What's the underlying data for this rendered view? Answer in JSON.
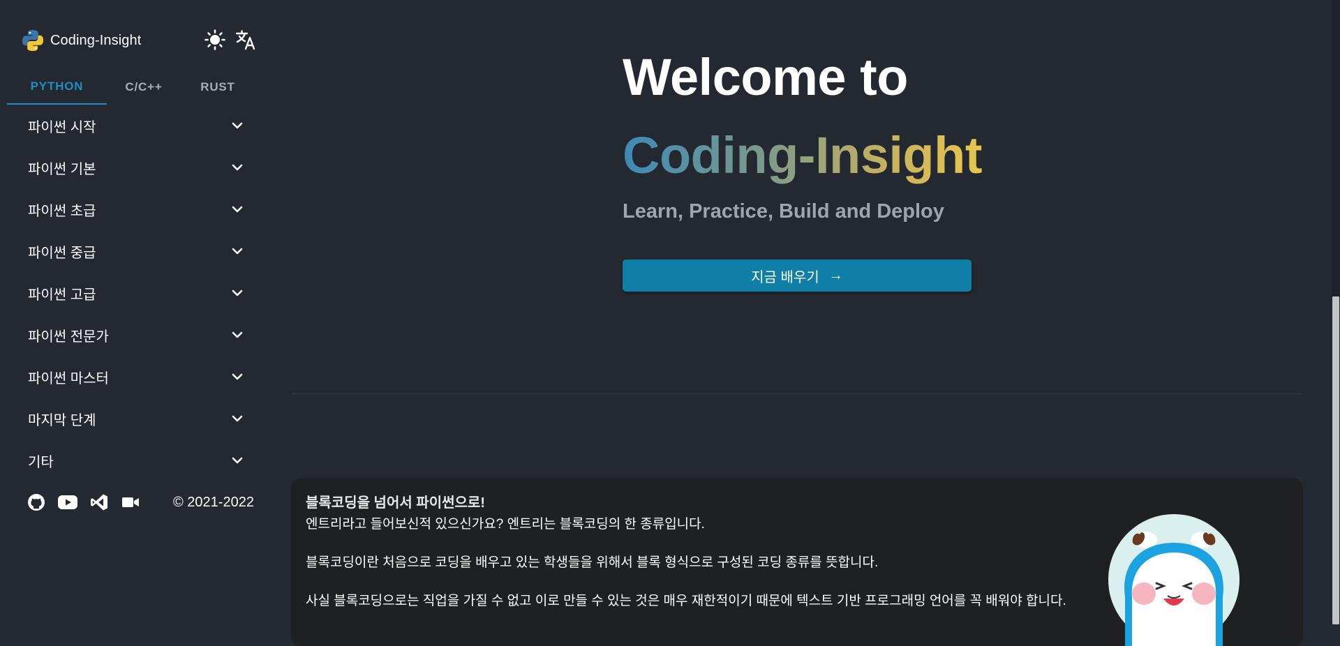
{
  "brand": {
    "name": "Coding-Insight"
  },
  "icons": {
    "logo": "python-logo-icon",
    "theme": "sun-icon",
    "language": "translate-icon",
    "chevron": "chevron-down-icon",
    "footer": [
      "github-icon",
      "youtube-icon",
      "vscode-icon",
      "video-camera-icon"
    ]
  },
  "tabs": [
    {
      "label": "PYTHON",
      "active": true
    },
    {
      "label": "C/C++",
      "active": false
    },
    {
      "label": "RUST",
      "active": false
    }
  ],
  "menu": [
    {
      "label": "파이썬 시작"
    },
    {
      "label": "파이썬 기본"
    },
    {
      "label": "파이썬 초급"
    },
    {
      "label": "파이썬 중급"
    },
    {
      "label": "파이썬 고급"
    },
    {
      "label": "파이썬 전문가"
    },
    {
      "label": "파이썬 마스터"
    },
    {
      "label": "마지막 단계"
    },
    {
      "label": "기타"
    }
  ],
  "footer": {
    "copyright": "© 2021-2022"
  },
  "hero": {
    "title": "Welcome to",
    "brand": "Coding-Insight",
    "subtitle": "Learn, Practice, Build and Deploy",
    "cta_label": "지금 배우기",
    "cta_arrow": "→"
  },
  "intro": {
    "title": "블록코딩을 넘어서 파이썬으로!",
    "paragraphs": [
      "엔트리라고 들어보신적 있으신가요? 엔트리는 블록코딩의 한 종류입니다.",
      "블록코딩이란 처음으로 코딩을 배우고 있는 학생들을 위해서 블록 형식으로 구성된 코딩 종류를 뜻합니다.",
      "사실 블록코딩으로는 직업을 가질 수 없고 이로 만들 수 있는 것은 매우 재한적이기 때문에 텍스트 기반 프로그래밍 언어를 꼭 배워야 합니다."
    ]
  },
  "colors": {
    "background": "#242830",
    "accent": "#1e8fbf",
    "button": "#0f7fa8",
    "card": "#1f2021",
    "gradient": [
      "#3c8ab5",
      "#7d9a8a",
      "#c9b35c",
      "#e8c64e"
    ]
  }
}
